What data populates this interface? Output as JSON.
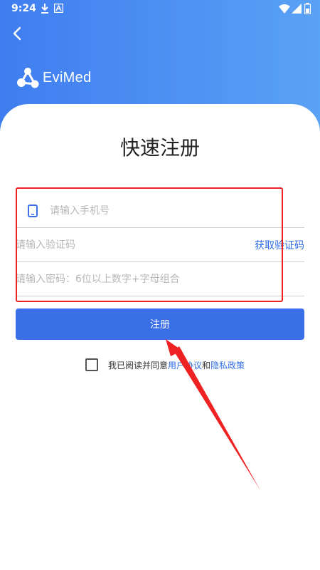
{
  "status_bar": {
    "time": "9:24"
  },
  "brand": {
    "name": "EviMed"
  },
  "page": {
    "title": "快速注册"
  },
  "form": {
    "phone_placeholder": "请输入手机号",
    "code_placeholder": "请输入验证码",
    "password_placeholder": "请输入密码：6位以上数字+字母组合",
    "get_code_label": "获取验证码",
    "submit_label": "注册"
  },
  "agreement": {
    "prefix": "我已阅读并同意",
    "user_agreement": "用户协议",
    "conjunction": "和",
    "privacy_policy": "隐私政策"
  },
  "colors": {
    "header_start": "#3f7df0",
    "header_end": "#5aa2f5",
    "primary": "#3a6fe8",
    "link": "#2f6ce5",
    "annotation": "#ee2222"
  },
  "icons": [
    "download-icon",
    "a-icon",
    "wifi-icon",
    "signal-icon",
    "battery-icon",
    "back-arrow-icon",
    "evimed-logo-icon",
    "phone-icon",
    "annotation-arrow"
  ]
}
